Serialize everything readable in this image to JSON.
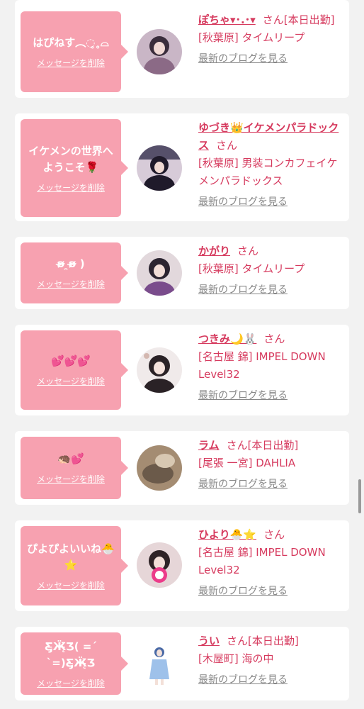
{
  "cards": [
    {
      "message": "はぴねす︵◌̥˳⌓",
      "delete_label": "メッセージを削除",
      "name": "ぽちゃ▾･.･▾",
      "suffix": "さん[本日出勤]",
      "location": "[秋葉原] タイムリープ",
      "blog_label": "最新のブログを見る",
      "avatar_colors": [
        "#3a2d3c",
        "#8b6a86",
        "#c9b6c6"
      ]
    },
    {
      "message": "イケメンの世界へようこそ🌹",
      "delete_label": "メッセージを削除",
      "name": "ゆづき👑イケメンパラドックス",
      "suffix": "さん",
      "location": "[秋葉原] 男装コンカフェイケメンパラドックス",
      "blog_label": "最新のブログを見る",
      "avatar_colors": [
        "#1f1a2a",
        "#56506a",
        "#d7cbd8"
      ]
    },
    {
      "message": "ʚ̴̶̷ ̯ʚ̴̶̷ )",
      "delete_label": "メッセージを削除",
      "name": "かがり",
      "suffix": "さん",
      "location": "[秋葉原] タイムリープ",
      "blog_label": "最新のブログを見る",
      "avatar_colors": [
        "#2b2430",
        "#7a4c8c",
        "#e2d8dc"
      ]
    },
    {
      "message": "💕💕💕",
      "delete_label": "メッセージを削除",
      "name": "つきみ🌙🐰",
      "suffix": "さん",
      "location": "[名古屋 錦] IMPEL DOWN Level32",
      "blog_label": "最新のブログを見る",
      "avatar_colors": [
        "#f0eaea",
        "#2a2226",
        "#d4b8b0"
      ]
    },
    {
      "message": "🦔💕",
      "delete_label": "メッセージを削除",
      "name": "ラム",
      "suffix": "さん[本日出勤]",
      "location": "[尾張 一宮] DAHLIA",
      "blog_label": "最新のブログを見る",
      "avatar_colors": [
        "#6b5a4a",
        "#a48c72",
        "#d8c8b2"
      ]
    },
    {
      "message": "ぴよぴよいいね🐣⭐",
      "delete_label": "メッセージを削除",
      "name": "ひより🐣⭐",
      "suffix": "さん",
      "location": "[名古屋 錦] IMPEL DOWN Level32",
      "blog_label": "最新のブログを見る",
      "avatar_colors": [
        "#e6d6d8",
        "#2e2326",
        "#ec3c8a"
      ]
    },
    {
      "message": "Ƹ̵̡Ӝ̵̨̄Ʒ( =ˊ ˋ=)Ƹ̵̡Ӝ̵̨̄Ʒ",
      "delete_label": "メッセージを削除",
      "name": "うい",
      "suffix": "さん[本日出勤]",
      "location": "[木屋町] 海の中",
      "blog_label": "最新のブログを見る",
      "avatar_colors": [
        "#ffffff",
        "#4a6aa6",
        "#9ec1ea"
      ]
    }
  ]
}
